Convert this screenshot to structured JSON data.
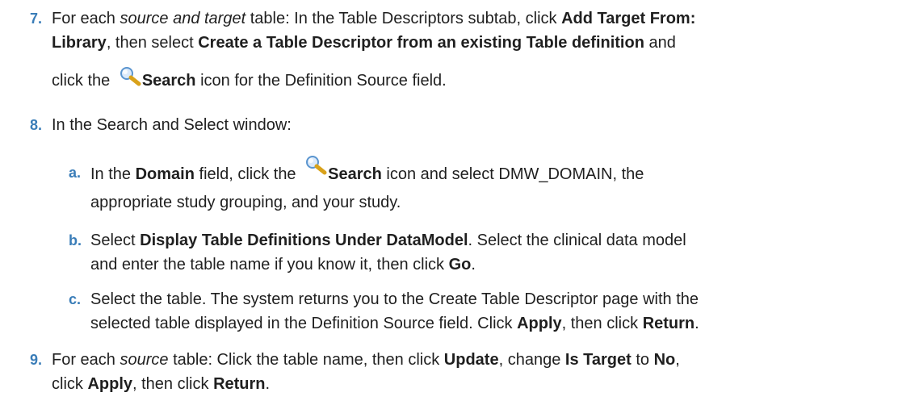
{
  "steps": [
    {
      "num": "7.",
      "l1_a": "For each ",
      "l1_i": "source and target",
      "l1_b": " table: In the Table Descriptors subtab, click ",
      "l1_bold": "Add Target From:",
      "l2_bold1": "Library",
      "l2_a": ", then select ",
      "l2_bold2": "Create a Table Descriptor from an existing Table definition",
      "l2_b": " and",
      "l3_a": "click the ",
      "l3_bold": "Search",
      "l3_b": " icon for the Definition Source field."
    },
    {
      "num": "8.",
      "text": "In the Search and Select window:"
    },
    {
      "num": "9.",
      "l1_a": "For each ",
      "l1_i": "source",
      "l1_b": " table: Click the table name, then click ",
      "l1_bold1": "Update",
      "l1_c": ", change ",
      "l1_bold2": "Is Target",
      "l1_d": " to ",
      "l1_bold3": "No",
      "l1_e": ",",
      "l2_a": "click ",
      "l2_bold1": "Apply",
      "l2_b": ", then click ",
      "l2_bold2": "Return",
      "l2_c": "."
    }
  ],
  "substeps": [
    {
      "num": "a.",
      "l1_a": "In the ",
      "l1_bold1": "Domain",
      "l1_b": " field, click the ",
      "l1_bold2": "Search",
      "l1_c": " icon and select DMW_DOMAIN, the",
      "l2": "appropriate study grouping, and your study."
    },
    {
      "num": "b.",
      "l1_a": "Select ",
      "l1_bold": "Display Table Definitions Under DataModel",
      "l1_b": ". Select the clinical data model",
      "l2_a": "and enter the table name if you know it, then click ",
      "l2_bold": "Go",
      "l2_b": "."
    },
    {
      "num": "c.",
      "l1": "Select the table. The system returns you to the Create Table Descriptor page with the",
      "l2_a": "selected table displayed in the Definition Source field. Click ",
      "l2_bold1": "Apply",
      "l2_b": ", then click ",
      "l2_bold2": "Return",
      "l2_c": "."
    }
  ],
  "icons": {
    "search": "search-icon",
    "lens_color": "#7fb2e5",
    "handle_color": "#d9a21b"
  }
}
